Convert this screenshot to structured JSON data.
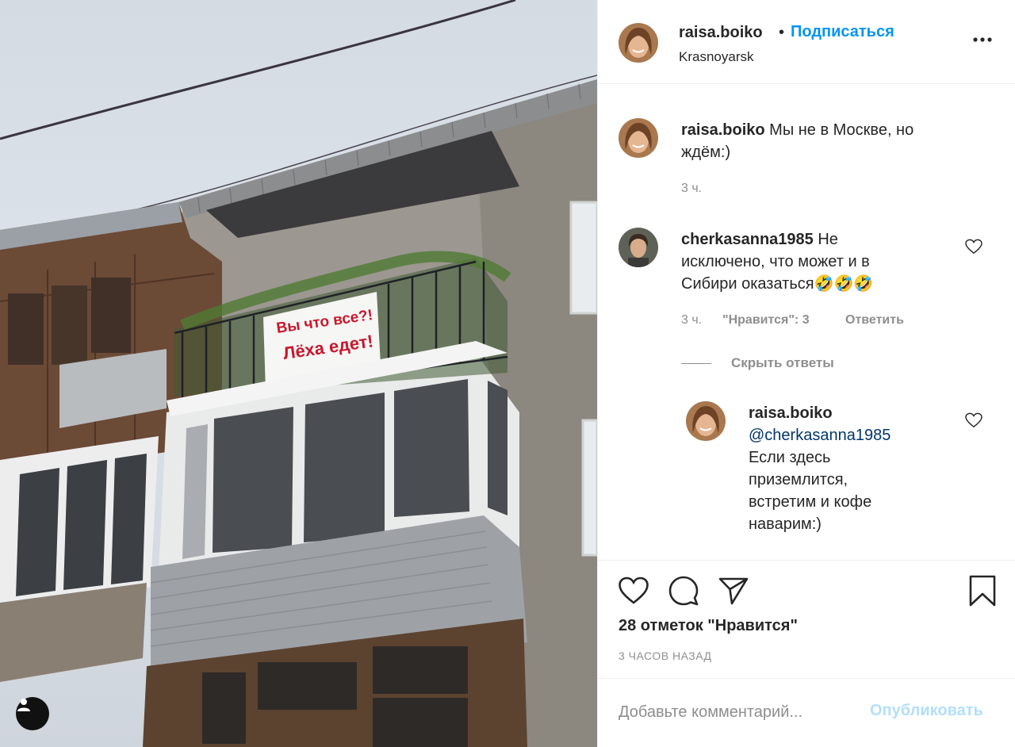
{
  "photo": {
    "banner_line1": "Вы что все?!",
    "banner_line2": "Лёха едет!",
    "tag_icon": "user-icon"
  },
  "header": {
    "username": "raisa.boiko",
    "dot": "•",
    "follow": "Подписаться",
    "location": "Krasnoyarsk",
    "more_icon": "more-icon"
  },
  "caption": {
    "username": "raisa.boiko",
    "text_line1": " Мы не в Москве, но",
    "text_line2": "ждём:)",
    "time": "3 ч."
  },
  "comment": {
    "username": "cherkasanna1985",
    "text_line1": " Не",
    "text_line2": "исключено, что может и в",
    "text_line3": "Сибири оказаться🤣🤣🤣",
    "time": "3 ч.",
    "likes": "\"Нравится\": 3",
    "reply": "Ответить"
  },
  "hide_replies": "Скрыть ответы",
  "reply": {
    "username": "raisa.boiko",
    "mention": "@cherkasanna1985",
    "line1": "Если здесь",
    "line2": "приземлится,",
    "line3": "встретим и кофе",
    "line4": "наварим:)"
  },
  "actions": {
    "like_icon": "heart-icon",
    "comment_icon": "comment-icon",
    "share_icon": "send-icon",
    "save_icon": "bookmark-icon"
  },
  "likes_count": "28 отметок \"Нравится\"",
  "posted_ago": "3 ЧАСОВ НАЗАД",
  "add_comment": {
    "placeholder": "Добавьте комментарий...",
    "publish": "Опубликовать"
  },
  "colors": {
    "link_blue": "#0095f6",
    "publish_disabled": "#b2dffc",
    "mention": "#00376b",
    "secondary_text": "#8e8e8e",
    "banner_red": "#c8172d"
  }
}
